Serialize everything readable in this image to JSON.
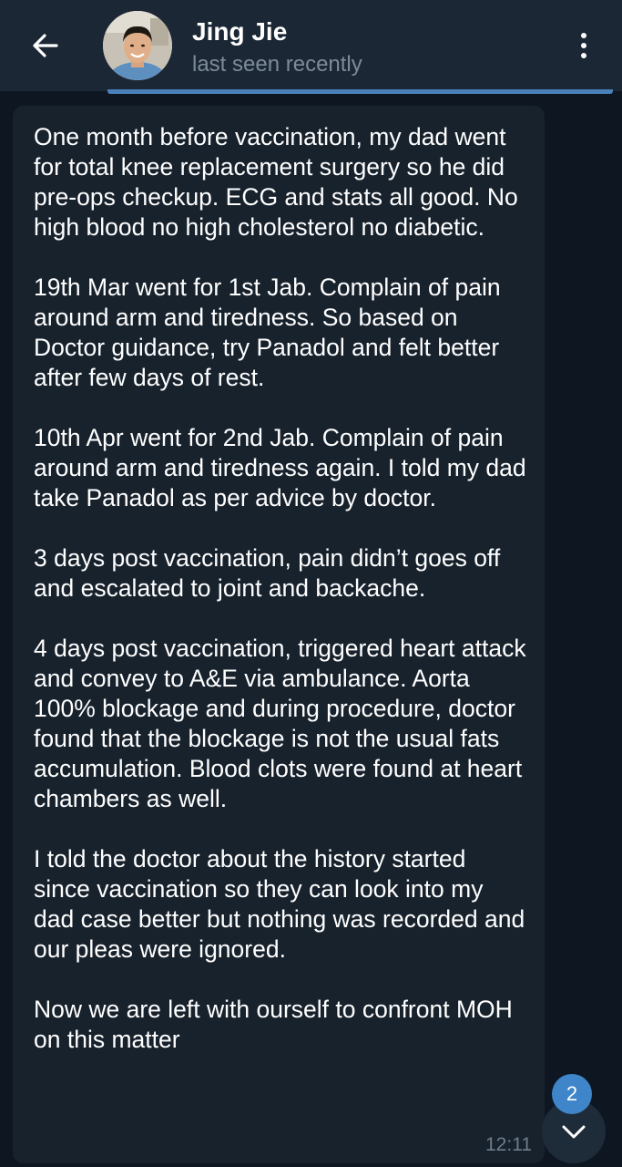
{
  "header": {
    "title": "Jing Jie",
    "status": "last seen recently",
    "back_icon": "arrow-left-icon",
    "menu_icon": "more-vertical-icon"
  },
  "message": {
    "paragraphs": [
      "One month before vaccination, my dad went for total knee replacement surgery so he did pre-ops checkup. ECG and stats all good. No high blood no high cholesterol no diabetic.",
      "19th Mar went for 1st Jab. Complain of pain around arm and tiredness. So based on Doctor guidance, try Panadol and felt better after few days of rest.",
      "10th Apr went for 2nd Jab. Complain of pain around arm and tiredness again. I told my dad take Panadol as per advice by doctor.",
      "3 days post vaccination, pain didn’t goes off and escalated to joint and backache.",
      "4 days post vaccination, triggered heart attack and convey to A&E via ambulance. Aorta 100% blockage and during procedure, doctor found that the blockage is not the usual fats accumulation. Blood clots were found at heart chambers as well.",
      "I told the doctor about the history started since vaccination so they can look into my dad case better but nothing was recorded and our pleas were ignored.",
      "Now we are left with ourself to confront MOH on this matter"
    ],
    "time": "12:11"
  },
  "scroll_down": {
    "unread_count": "2",
    "icon": "chevron-down-icon"
  },
  "colors": {
    "background": "#0e1621",
    "header": "#1b2735",
    "bubble": "#18222d",
    "accent": "#3e86c9",
    "muted_text": "#7d8b99"
  }
}
